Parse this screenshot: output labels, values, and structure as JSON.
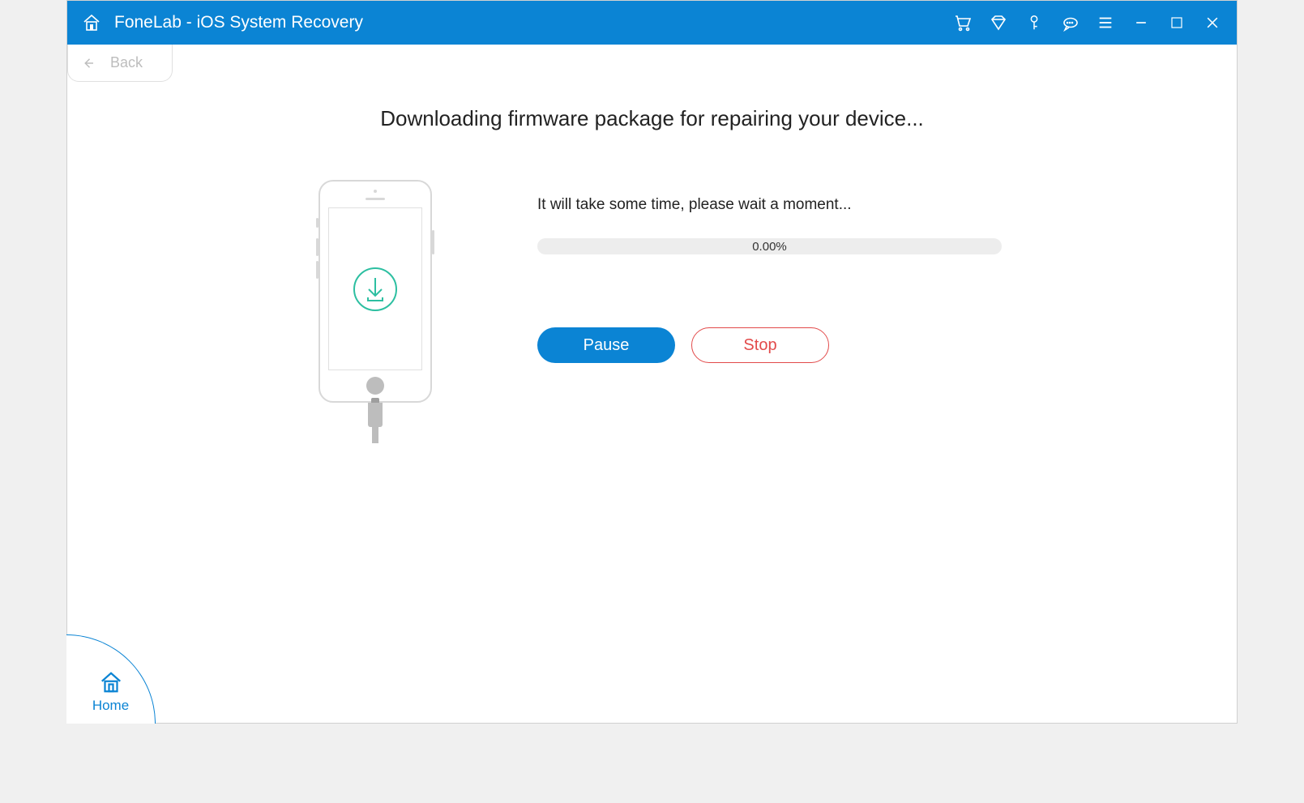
{
  "titlebar": {
    "title": "FoneLab - iOS System Recovery"
  },
  "back": {
    "label": "Back"
  },
  "main": {
    "heading": "Downloading firmware package for repairing your device...",
    "wait_text": "It will take some time, please wait a moment...",
    "progress_text": "0.00%"
  },
  "buttons": {
    "pause_label": "Pause",
    "stop_label": "Stop"
  },
  "home": {
    "label": "Home"
  },
  "icons": {
    "cart": "cart-icon",
    "diamond": "diamond-icon",
    "key": "key-icon",
    "speech": "speech-icon",
    "menu": "menu-icon",
    "minimize": "minimize-icon",
    "maximize": "maximize-icon",
    "close": "close-icon"
  }
}
